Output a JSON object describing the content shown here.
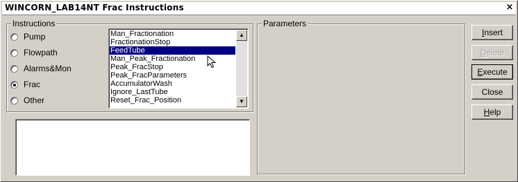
{
  "window": {
    "title": "WINCORN_LAB14NT Frac Instructions",
    "close_glyph": "×"
  },
  "instructions": {
    "group_label": "Instructions",
    "categories": [
      {
        "label": "Pump",
        "selected": false
      },
      {
        "label": "Flowpath",
        "selected": false
      },
      {
        "label": "Alarms&Mon",
        "selected": false
      },
      {
        "label": "Frac",
        "selected": true
      },
      {
        "label": "Other",
        "selected": false
      }
    ],
    "list_items": [
      "Man_Fractionation",
      "FractionationStop",
      "FeedTube",
      "Man_Peak_Fractionation",
      "Peak_FracStop",
      "Peak_FracParameters",
      "AccumulatorWash",
      "Ignore_LastTube",
      "Reset_Frac_Position"
    ],
    "selected_item": "FeedTube",
    "description_text": ""
  },
  "parameters": {
    "group_label": "Parameters"
  },
  "buttons": {
    "insert": {
      "label_mnemonic": "I",
      "label_rest": "nsert",
      "enabled": true
    },
    "delete": {
      "label_mnemonic": "D",
      "label_rest": "elete",
      "enabled": false
    },
    "execute": {
      "label_mnemonic": "E",
      "label_rest": "xecute",
      "enabled": true
    },
    "close": {
      "label": "Close",
      "enabled": true
    },
    "help": {
      "label_mnemonic": "H",
      "label_rest": "elp",
      "enabled": true
    }
  },
  "icons": {
    "scroll_up": "scroll-up-arrow-icon",
    "scroll_down": "scroll-down-arrow-icon",
    "cursor": "mouse-pointer-icon"
  },
  "colors": {
    "selection_bg": "#000080",
    "window_bg": "#d4d0c8"
  }
}
